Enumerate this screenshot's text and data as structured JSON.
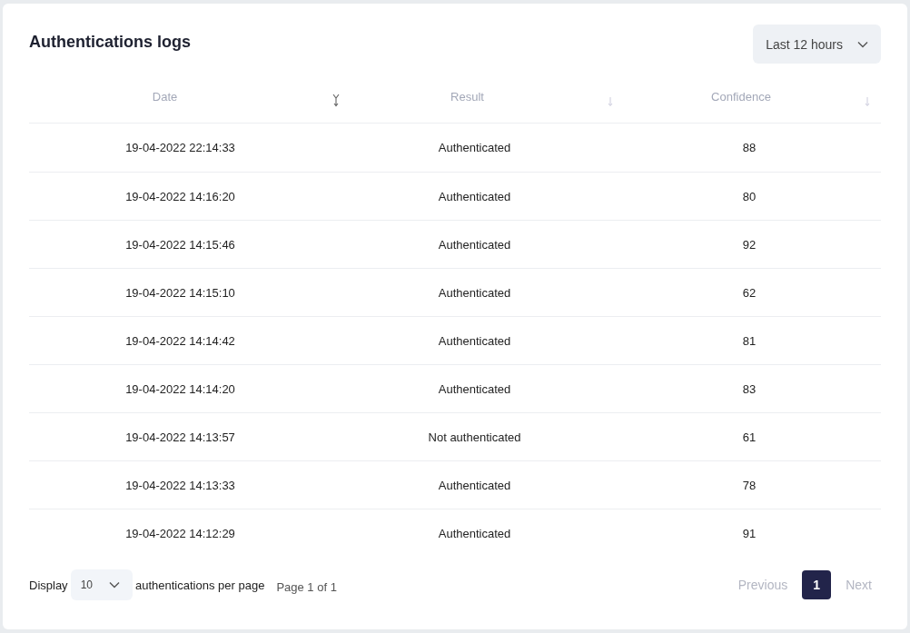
{
  "title": "Authentications logs",
  "range_select": {
    "value": "Last 12 hours"
  },
  "columns": [
    {
      "label": "Date",
      "sorted": true
    },
    {
      "label": "Result",
      "sorted": false
    },
    {
      "label": "Confidence",
      "sorted": false
    }
  ],
  "rows": [
    [
      "19-04-2022 22:14:33",
      "Authenticated",
      "88"
    ],
    [
      "19-04-2022 14:16:20",
      "Authenticated",
      "80"
    ],
    [
      "19-04-2022 14:15:46",
      "Authenticated",
      "92"
    ],
    [
      "19-04-2022 14:15:10",
      "Authenticated",
      "62"
    ],
    [
      "19-04-2022 14:14:42",
      "Authenticated",
      "81"
    ],
    [
      "19-04-2022 14:14:20",
      "Authenticated",
      "83"
    ],
    [
      "19-04-2022 14:13:57",
      "Not authenticated",
      "61"
    ],
    [
      "19-04-2022 14:13:33",
      "Authenticated",
      "78"
    ],
    [
      "19-04-2022 14:12:29",
      "Authenticated",
      "91"
    ]
  ],
  "footer": {
    "display_label": "Display",
    "page_size": "10",
    "per_page_label": "authentications per page",
    "page_info": "Page 1 of 1"
  },
  "pagination": {
    "previous": "Previous",
    "pages": [
      {
        "label": "1",
        "selected": true
      }
    ],
    "next": "Next"
  }
}
